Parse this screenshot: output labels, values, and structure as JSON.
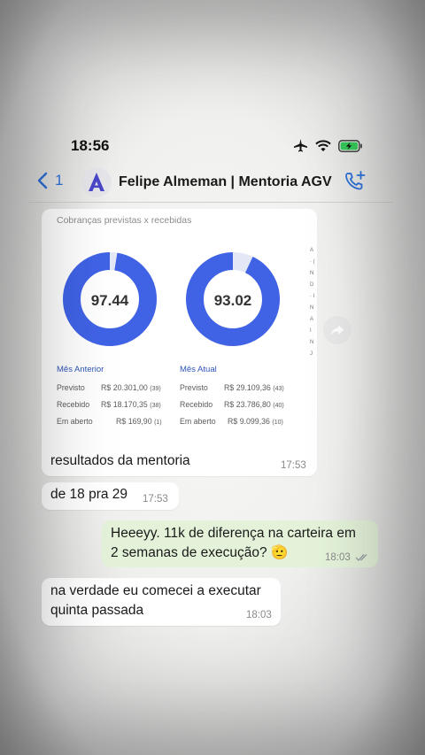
{
  "status_bar": {
    "time": "18:56"
  },
  "header": {
    "back_count": "1",
    "contact_name": "Felipe Almeman | Mentoria AGV"
  },
  "card": {
    "title": "Cobranças previstas x recebidas",
    "left": {
      "gauge_value": "97.44",
      "fill_percent": 97.44,
      "heading": "Mês Anterior",
      "rows": [
        {
          "label": "Previsto",
          "value": "R$ 20.301,00",
          "count": "(39)"
        },
        {
          "label": "Recebido",
          "value": "R$ 18.170,35",
          "count": "(38)"
        },
        {
          "label": "Em aberto",
          "value": "R$ 169,90",
          "count": "(1)"
        }
      ]
    },
    "right": {
      "gauge_value": "93.02",
      "fill_percent": 93.02,
      "heading": "Mês Atual",
      "rows": [
        {
          "label": "Previsto",
          "value": "R$ 29.109,36",
          "count": "(43)"
        },
        {
          "label": "Recebido",
          "value": "R$ 23.786,80",
          "count": "(40)"
        },
        {
          "label": "Em aberto",
          "value": "R$ 9.099,36",
          "count": "(10)"
        }
      ]
    },
    "caption": "resultados da mentoria",
    "time": "17:53",
    "side_letters": "A · ( N D · I N A I N J"
  },
  "messages": [
    {
      "direction": "in",
      "text": "de 18 pra 29",
      "time": "17:53"
    },
    {
      "direction": "out",
      "text_line1": "Heeeyy. 11k de diferença na carteira em",
      "text_line2": "2 semanas de execução? 🫡",
      "time": "18:03"
    },
    {
      "direction": "in",
      "text_line1": "na verdade eu comecei a executar",
      "text_line2": "quinta passada",
      "time": "18:03"
    }
  ],
  "colors": {
    "accent": "#2d6fd6",
    "donut": "#4063e6",
    "bubble_out": "#e3f2d9"
  }
}
